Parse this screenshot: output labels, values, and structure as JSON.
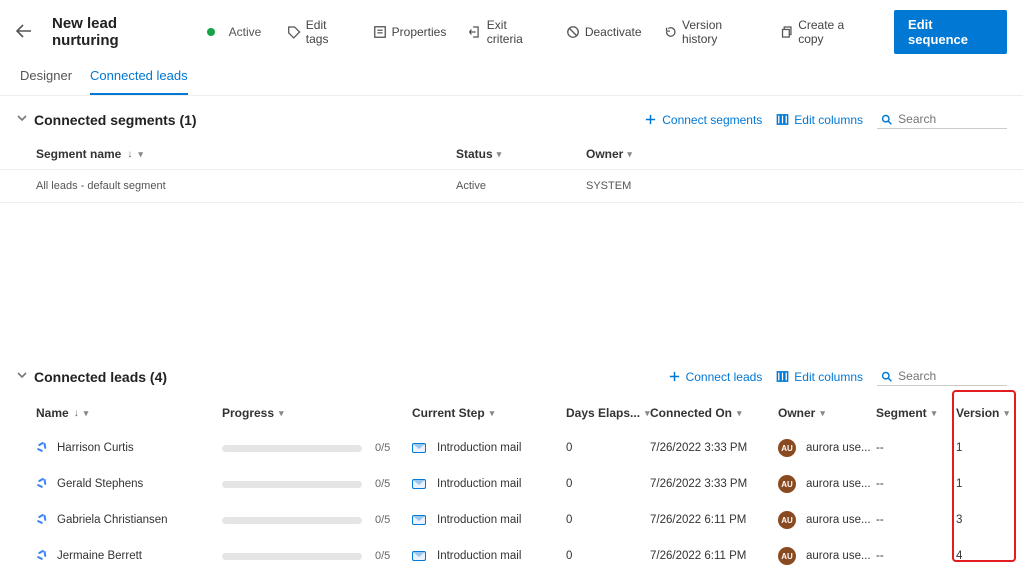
{
  "header": {
    "title": "New lead nurturing",
    "status": "Active",
    "actions": {
      "edit_tags": "Edit tags",
      "properties": "Properties",
      "exit_criteria": "Exit criteria",
      "deactivate": "Deactivate",
      "version_history": "Version history",
      "create_copy": "Create a copy",
      "edit_sequence": "Edit sequence"
    }
  },
  "tabs": {
    "designer": "Designer",
    "connected_leads": "Connected leads"
  },
  "segments_section": {
    "title": "Connected segments (1)",
    "actions": {
      "connect": "Connect segments",
      "edit_columns": "Edit columns",
      "search_placeholder": "Search"
    },
    "columns": {
      "segment_name": "Segment name",
      "status": "Status",
      "owner": "Owner"
    },
    "rows": [
      {
        "name": "All leads - default segment",
        "status": "Active",
        "owner": "SYSTEM"
      }
    ]
  },
  "leads_section": {
    "title": "Connected leads (4)",
    "actions": {
      "connect": "Connect leads",
      "edit_columns": "Edit columns",
      "search_placeholder": "Search"
    },
    "columns": {
      "name": "Name",
      "progress": "Progress",
      "current_step": "Current Step",
      "days": "Days Elaps...",
      "connected": "Connected On",
      "owner": "Owner",
      "segment": "Segment",
      "version": "Version"
    },
    "owner_initials": "AU",
    "rows": [
      {
        "name": "Harrison Curtis",
        "progress": "0/5",
        "step": "Introduction mail",
        "days": "0",
        "connected": "7/26/2022 3:33 PM",
        "owner": "aurora use...",
        "segment": "--",
        "version": "1"
      },
      {
        "name": "Gerald Stephens",
        "progress": "0/5",
        "step": "Introduction mail",
        "days": "0",
        "connected": "7/26/2022 3:33 PM",
        "owner": "aurora use...",
        "segment": "--",
        "version": "1"
      },
      {
        "name": "Gabriela Christiansen",
        "progress": "0/5",
        "step": "Introduction mail",
        "days": "0",
        "connected": "7/26/2022 6:11 PM",
        "owner": "aurora use...",
        "segment": "--",
        "version": "3"
      },
      {
        "name": "Jermaine Berrett",
        "progress": "0/5",
        "step": "Introduction mail",
        "days": "0",
        "connected": "7/26/2022 6:11 PM",
        "owner": "aurora use...",
        "segment": "--",
        "version": "4"
      }
    ]
  }
}
